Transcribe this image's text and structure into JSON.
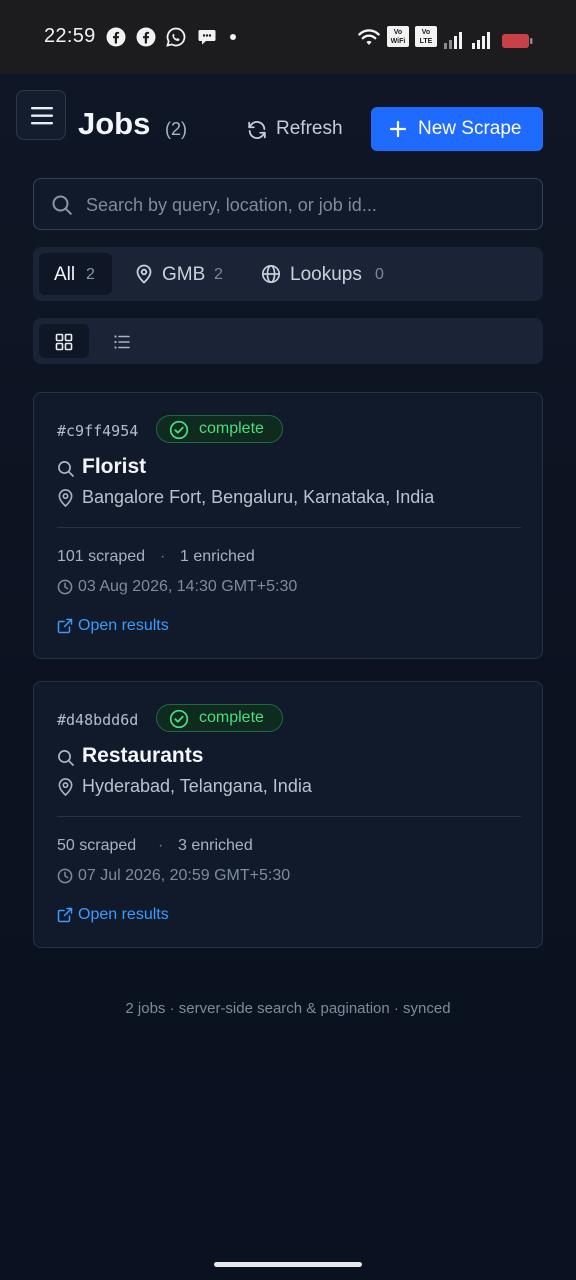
{
  "status_bar": {
    "time": "22:59",
    "app_icons": [
      "facebook-icon",
      "facebook-icon",
      "whatsapp-icon",
      "chat-bubble-icon",
      "dot-icon"
    ],
    "right_icons": [
      "wifi-icon",
      "vowifi-icon",
      "volte-icon",
      "signal-icon",
      "signal-icon",
      "battery-low-icon"
    ],
    "vowifi_label": "Vo WiFi",
    "volte_label": "Vo LTE",
    "battery_color": "#e5484d"
  },
  "header": {
    "menu_icon": "hamburger-icon",
    "title": "Jobs",
    "count": "(2)",
    "refresh_label": "Refresh",
    "new_scrape_label": "New Scrape",
    "accent_color": "#1f6bff"
  },
  "search": {
    "placeholder": "Search by query, location, or job id..."
  },
  "filters": [
    {
      "label": "All",
      "count": "2",
      "active": true
    },
    {
      "label": "GMB",
      "count": "2",
      "icon": "map-pin-icon"
    },
    {
      "label": "Lookups",
      "count": "0",
      "icon": "globe-icon"
    }
  ],
  "view_toggle": {
    "options": [
      "grid-icon",
      "list-icon"
    ],
    "active": "grid"
  },
  "jobs": [
    {
      "id": "#c9ff4954",
      "status": "complete",
      "query": "Florist",
      "location": "Bangalore Fort, Bengaluru, Karnataka, India",
      "scraped": "101 scraped",
      "enriched": "1 enriched",
      "separator": "·",
      "timestamp": "03 Aug 2026, 14:30 GMT+5:30",
      "link": "Open results"
    },
    {
      "id": "#d48bdd6d",
      "status": "complete",
      "query": "Restaurants",
      "location": "Hyderabad, Telangana, India",
      "scraped": "50 scraped",
      "enriched": "3 enriched",
      "separator": "·",
      "timestamp": "07 Jul 2026, 20:59 GMT+5:30",
      "link": "Open results"
    }
  ],
  "footer": "2 jobs · server-side search & pagination · synced",
  "colors": {
    "status_complete": "#4ade80",
    "link": "#3b9bff",
    "background": "#0c1322"
  }
}
